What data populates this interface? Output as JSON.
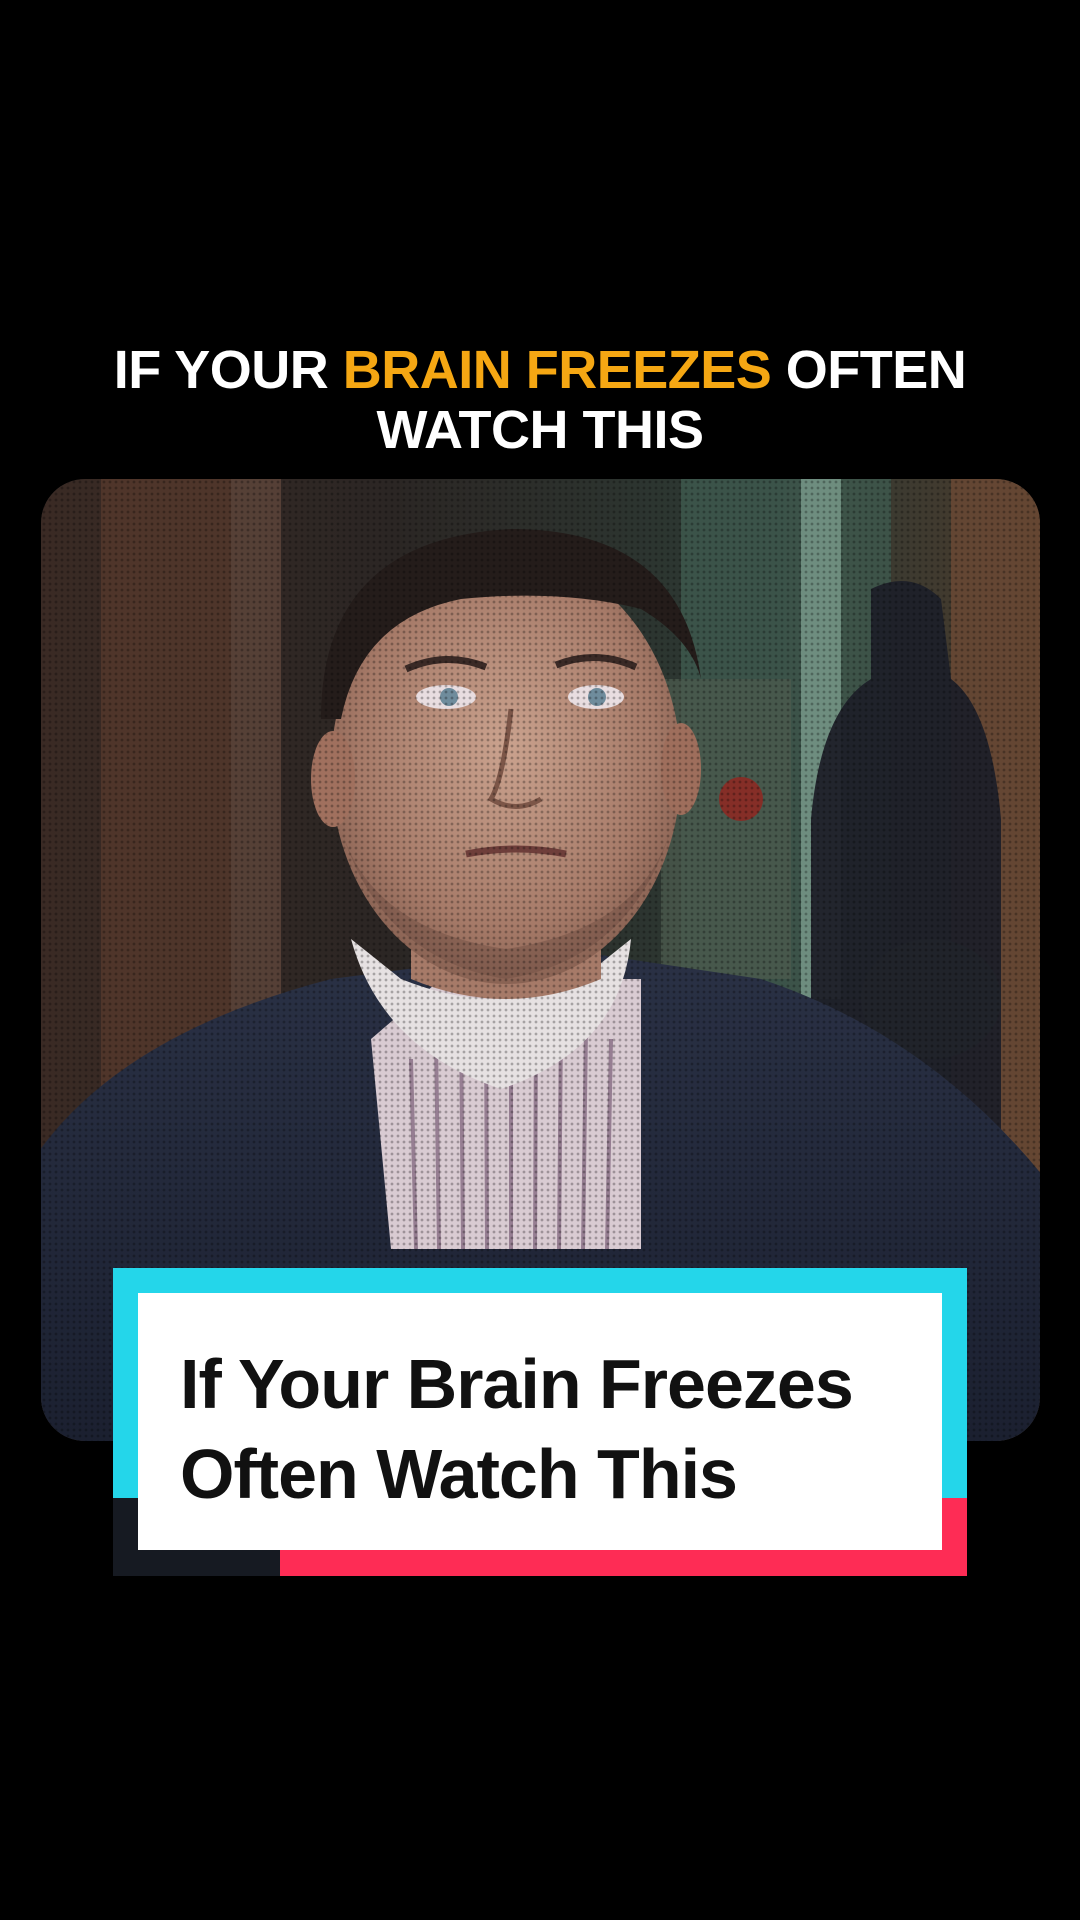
{
  "headline": {
    "part1": "IF YOUR ",
    "accent": "BRAIN FREEZES",
    "part2": " OFTEN",
    "line2": "WATCH THIS",
    "accent_color": "#f5a713"
  },
  "video": {
    "subject": "man-in-suit-icon"
  },
  "card": {
    "title_line1": "If Your Brain Freezes",
    "title_line2": "Often Watch This",
    "colors": {
      "cyan": "#24d6ea",
      "pink": "#fe2c55",
      "dark": "#161a22"
    }
  }
}
